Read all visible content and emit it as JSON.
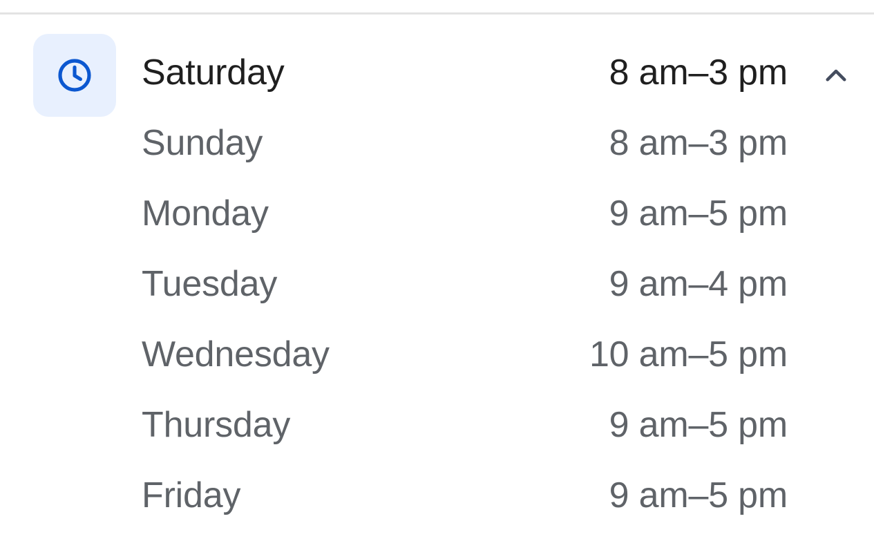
{
  "hours": {
    "toggle_icon": "chevron-up-icon",
    "clock_icon": "clock-icon",
    "colors": {
      "accent": "#0b57d0",
      "icon_tile_bg": "#e8f0fe",
      "current_day_text": "#1f1f1f",
      "other_day_text": "#5f6368",
      "chevron": "#444c5e"
    },
    "rows": [
      {
        "day": "Saturday",
        "time": "8 am–3 pm"
      },
      {
        "day": "Sunday",
        "time": "8 am–3 pm"
      },
      {
        "day": "Monday",
        "time": "9 am–5 pm"
      },
      {
        "day": "Tuesday",
        "time": "9 am–4 pm"
      },
      {
        "day": "Wednesday",
        "time": "10 am–5 pm"
      },
      {
        "day": "Thursday",
        "time": "9 am–5 pm"
      },
      {
        "day": "Friday",
        "time": "9 am–5 pm"
      }
    ]
  }
}
